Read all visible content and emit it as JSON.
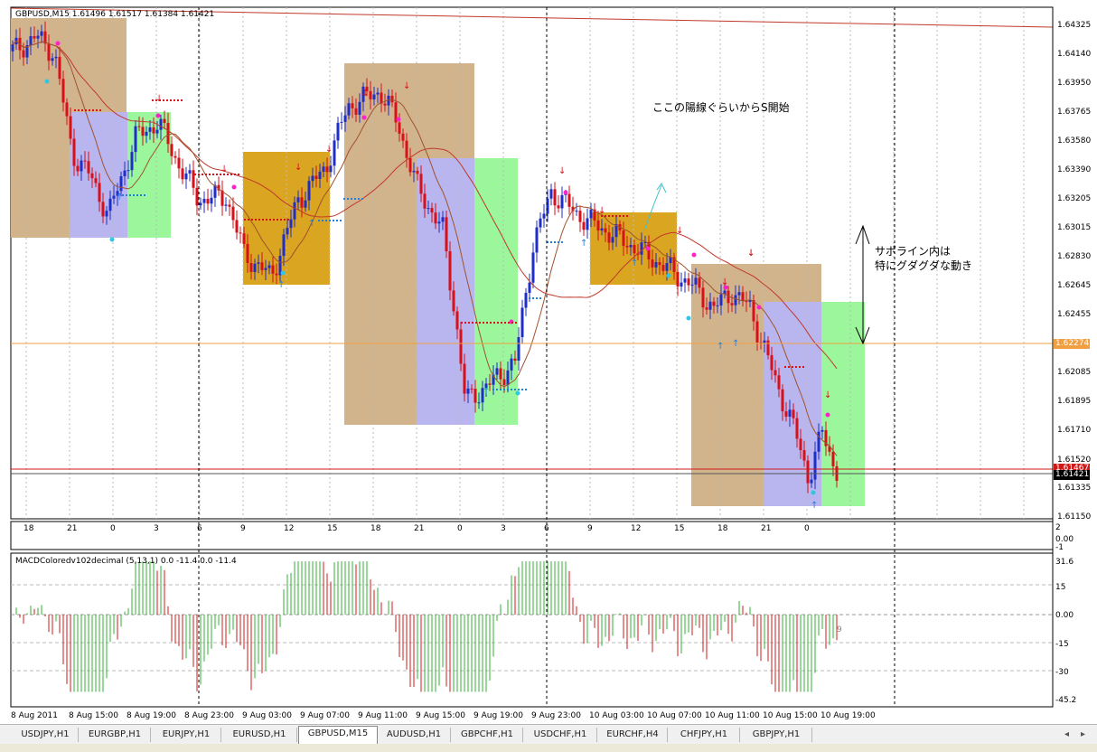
{
  "window": {
    "symbol_info": "GBPUSD,M15  1.61496 1.61517 1.61384 1.61421"
  },
  "annotations": {
    "top_note": "ここの陽線ぐらいからS開始",
    "side_note_line1": "サポライン内は",
    "side_note_line2": "特にグダグダな動き"
  },
  "price_axis": {
    "labels": [
      "1.64325",
      "1.64140",
      "1.63950",
      "1.63765",
      "1.63580",
      "1.63390",
      "1.63205",
      "1.63015",
      "1.62830",
      "1.62645",
      "1.62455",
      "1.62274",
      "1.62085",
      "1.61895",
      "1.61710",
      "1.61520",
      "1.61467",
      "1.61421",
      "1.61335",
      "1.61150"
    ],
    "highlight_orange": "1.62274",
    "highlight_red": "1.61467",
    "highlight_black": "1.61421"
  },
  "mini_panel": {
    "hour_labels": [
      "18",
      "21",
      "0",
      "3",
      "6",
      "9",
      "12",
      "15",
      "18",
      "21",
      "0",
      "3",
      "6",
      "9",
      "12",
      "15",
      "18",
      "21",
      "0"
    ],
    "axis_labels": [
      "2",
      "0.00",
      "-1"
    ]
  },
  "macd": {
    "title": "MACDColoredv102decimal (5,13,1) 0.0 -11.4 0.0 -11.4",
    "axis_labels": [
      "31.6",
      "15",
      "0.00",
      "-15",
      "-30",
      "-45.2"
    ],
    "trailing_value": "9"
  },
  "time_axis": {
    "labels": [
      "8 Aug 2011",
      "8 Aug 15:00",
      "8 Aug 19:00",
      "8 Aug 23:00",
      "9 Aug 03:00",
      "9 Aug 07:00",
      "9 Aug 11:00",
      "9 Aug 15:00",
      "9 Aug 19:00",
      "9 Aug 23:00",
      "10 Aug 03:00",
      "10 Aug 07:00",
      "10 Aug 11:00",
      "10 Aug 15:00",
      "10 Aug 19:00"
    ]
  },
  "tabs": [
    "USDJPY,H1",
    "EURGBP,H1",
    "EURJPY,H1",
    "EURUSD,H1",
    "GBPUSD,M15",
    "AUDUSD,H1",
    "GBPCHF,H1",
    "USDCHF,H1",
    "EURCHF,H4",
    "CHFJPY,H1",
    "GBPJPY,H1"
  ],
  "active_tab": "GBPUSD,M15",
  "colors": {
    "bull_candle": "#1f2ec8",
    "bear_candle": "#d8101a",
    "ma_line": "#c0392b",
    "support_line": "#f0a040",
    "box_tan": "#d2b48c",
    "box_purple": "#b9b5ef",
    "box_green": "#9cf79c",
    "box_gold": "#daa520",
    "macd_up": "#30b030",
    "macd_down": "#d01818"
  }
}
